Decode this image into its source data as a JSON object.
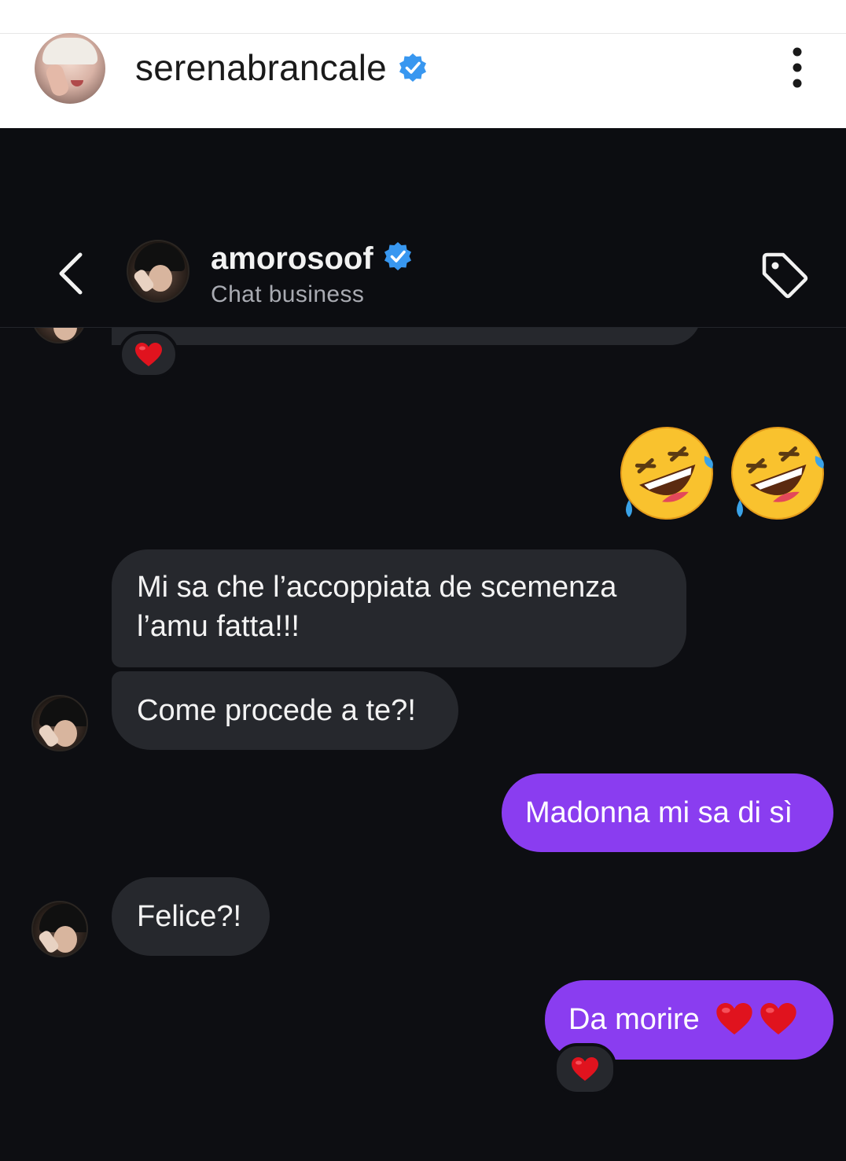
{
  "post": {
    "username": "serenabrancale",
    "verified_icon": "verified-badge-icon",
    "more_icon": "more-vertical-icon"
  },
  "dm": {
    "contact_name": "amorosoof",
    "contact_subtitle": "Chat business",
    "back_icon": "chevron-left-icon",
    "tag_icon": "tag-icon"
  },
  "messages": [
    {
      "from": "contact",
      "type": "reaction-only",
      "reaction": "red-heart"
    },
    {
      "from": "me",
      "type": "emoji",
      "emoji": [
        "rolling-on-the-floor-laughing",
        "rolling-on-the-floor-laughing"
      ]
    },
    {
      "from": "contact",
      "text": "Mi sa che l’accoppiata de scemenza\nl’amu fatta!!!"
    },
    {
      "from": "contact",
      "text": "Come procede a te?!"
    },
    {
      "from": "me",
      "text": "Madonna mi sa di sì"
    },
    {
      "from": "contact",
      "text": "Felice?!"
    },
    {
      "from": "me",
      "text": "Da morire",
      "trailing_emoji": [
        "red-heart",
        "red-heart"
      ],
      "reaction": "red-heart"
    }
  ],
  "colors": {
    "outgoing_bubble": "#8a3df0",
    "incoming_bubble": "#26282d",
    "background": "#0d0e12",
    "verified": "#3897f0"
  }
}
